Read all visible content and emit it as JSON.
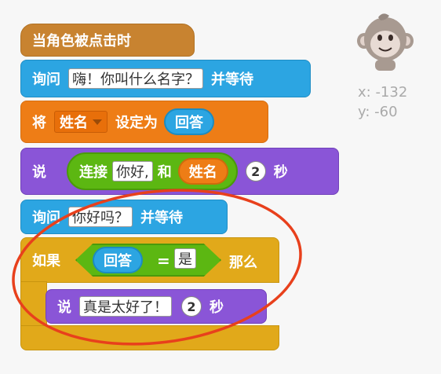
{
  "blocks": {
    "when_clicked": "当角色被点击时",
    "ask_prefix": "询问",
    "ask_value": "嗨！你叫什么名字？",
    "ask_suffix": "并等待",
    "set_prefix": "将",
    "set_var": "姓名",
    "set_mid": "设定为",
    "set_value": "回答",
    "say_label": "说",
    "join_label": "连接",
    "join_a": "你好,",
    "join_and": "和",
    "join_b": "姓名",
    "say_secs_value": "2",
    "say_secs_unit": "秒",
    "ask2_prefix": "询问",
    "ask2_value": "你好吗？",
    "ask2_suffix": "并等待",
    "if_label": "如果",
    "if_left": "回答",
    "if_op": "=",
    "if_right": "是",
    "if_then": "那么",
    "inner_say_label": "说",
    "inner_say_value": "真是太好了！",
    "inner_secs_value": "2",
    "inner_secs_unit": "秒"
  },
  "sprite": {
    "name": "monkey-sprite",
    "x_label": "x: -132",
    "y_label": "y: -60"
  },
  "annotation": {
    "color": "#e8401c"
  }
}
